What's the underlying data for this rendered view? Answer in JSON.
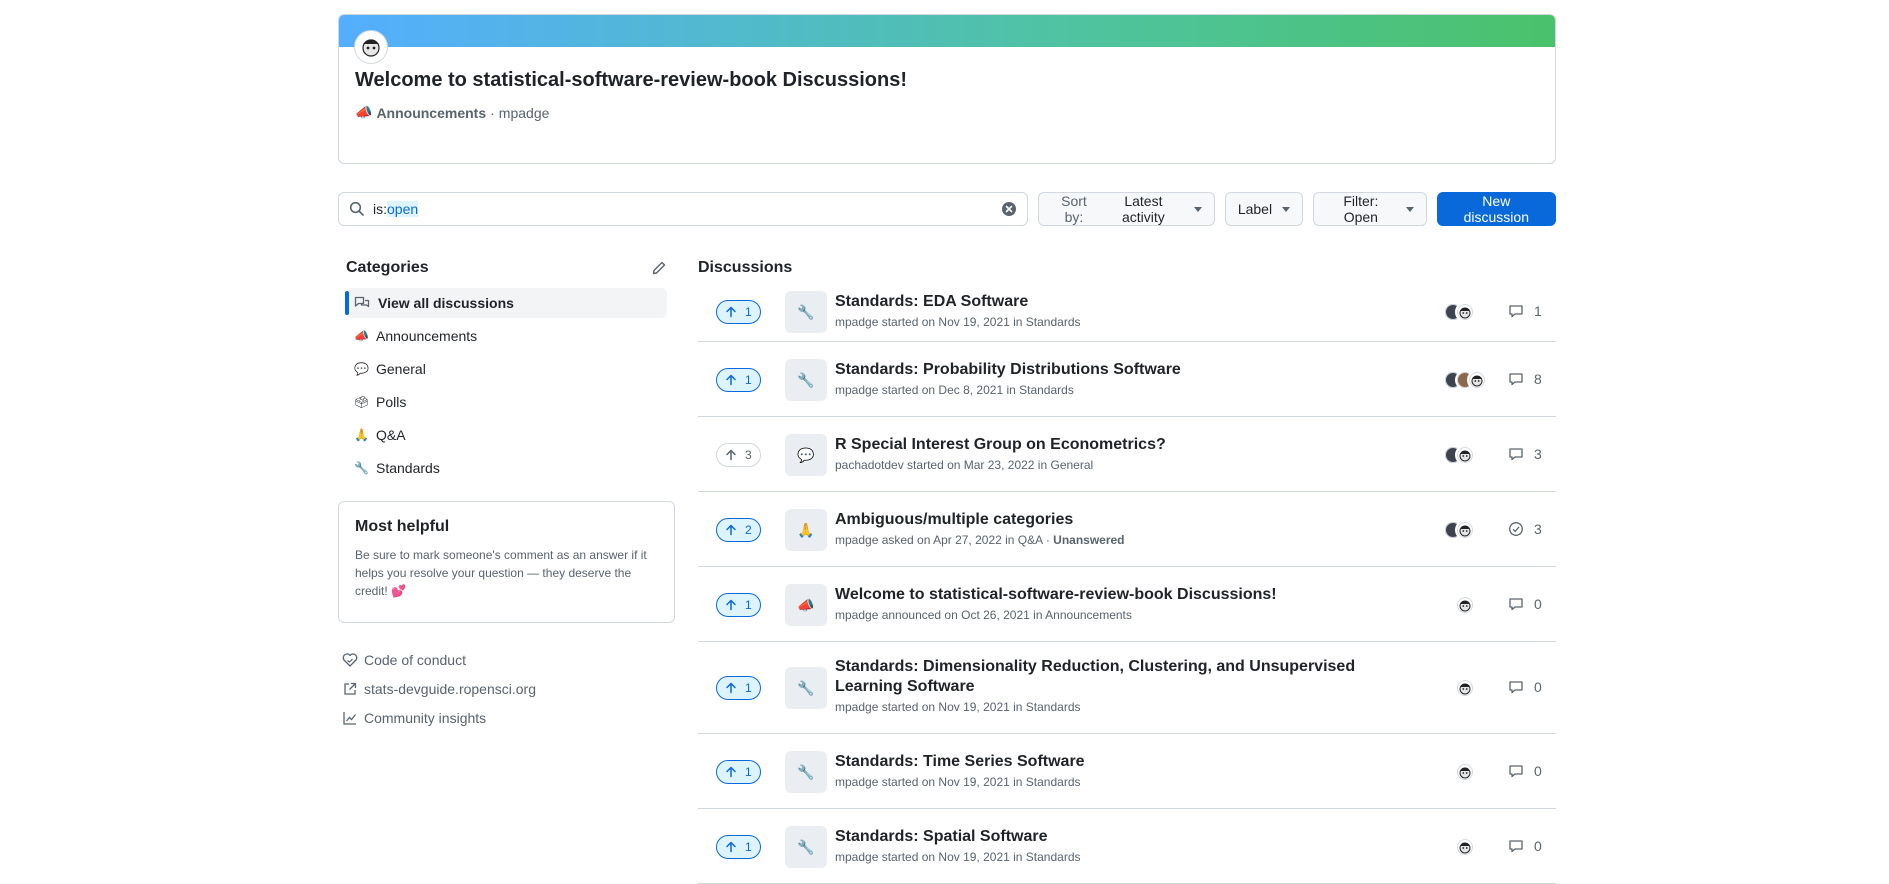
{
  "announcement": {
    "title": "Welcome to statistical-software-review-book Discussions!",
    "category_emoji": "📣",
    "category": "Announcements",
    "separator": "·",
    "author": "mpadge"
  },
  "search": {
    "prefix": "is:",
    "value": "open"
  },
  "toolbar": {
    "sort_label": "Sort by:",
    "sort_value": "Latest activity",
    "label_button": "Label",
    "filter_button": "Filter: Open",
    "new_discussion": "New discussion"
  },
  "sidebar": {
    "title": "Categories",
    "items": [
      {
        "emoji": "🗨",
        "label": "View all discussions"
      },
      {
        "emoji": "📣",
        "label": "Announcements"
      },
      {
        "emoji": "💬",
        "label": "General"
      },
      {
        "emoji": "🗳",
        "label": "Polls"
      },
      {
        "emoji": "🙏",
        "label": "Q&A"
      },
      {
        "emoji": "🔧",
        "label": "Standards"
      }
    ],
    "most_helpful": {
      "title": "Most helpful",
      "text": "Be sure to mark someone's comment as an answer if it helps you resolve your question — they deserve the credit! 💕"
    },
    "links": {
      "code_of_conduct": "Code of conduct",
      "devguide": "stats-devguide.ropensci.org",
      "insights": "Community insights"
    }
  },
  "discussions": {
    "title": "Discussions",
    "rows": [
      {
        "votes": "1",
        "emoji": "🔧",
        "title": "Standards: EDA Software",
        "meta": "mpadge started on Nov 19, 2021 in Standards",
        "extra": "",
        "comments": "1"
      },
      {
        "votes": "1",
        "emoji": "🔧",
        "title": "Standards: Probability Distributions Software",
        "meta": "mpadge started on Dec 8, 2021 in Standards",
        "extra": "",
        "comments": "8"
      },
      {
        "votes": "3",
        "emoji": "💬",
        "title": "R Special Interest Group on Econometrics?",
        "meta": "pachadotdev started on Mar 23, 2022 in General",
        "extra": "",
        "comments": "3"
      },
      {
        "votes": "2",
        "emoji": "🙏",
        "title": "Ambiguous/multiple categories",
        "meta": "mpadge asked on Apr 27, 2022 in Q&A ·",
        "extra": "Unanswered",
        "comments": "3"
      },
      {
        "votes": "1",
        "emoji": "📣",
        "title": "Welcome to statistical-software-review-book Discussions!",
        "meta": "mpadge announced on Oct 26, 2021 in Announcements",
        "extra": "",
        "comments": "0"
      },
      {
        "votes": "1",
        "emoji": "🔧",
        "title": "Standards: Dimensionality Reduction, Clustering, and Unsupervised Learning Software",
        "meta": "mpadge started on Nov 19, 2021 in Standards",
        "extra": "",
        "comments": "0"
      },
      {
        "votes": "1",
        "emoji": "🔧",
        "title": "Standards: Time Series Software",
        "meta": "mpadge started on Nov 19, 2021 in Standards",
        "extra": "",
        "comments": "0"
      },
      {
        "votes": "1",
        "emoji": "🔧",
        "title": "Standards: Spatial Software",
        "meta": "mpadge started on Nov 19, 2021 in Standards",
        "extra": "",
        "comments": "0"
      }
    ]
  },
  "colors": {
    "accent": "#0969da",
    "border": "#d0d7de",
    "muted": "#59636e"
  }
}
